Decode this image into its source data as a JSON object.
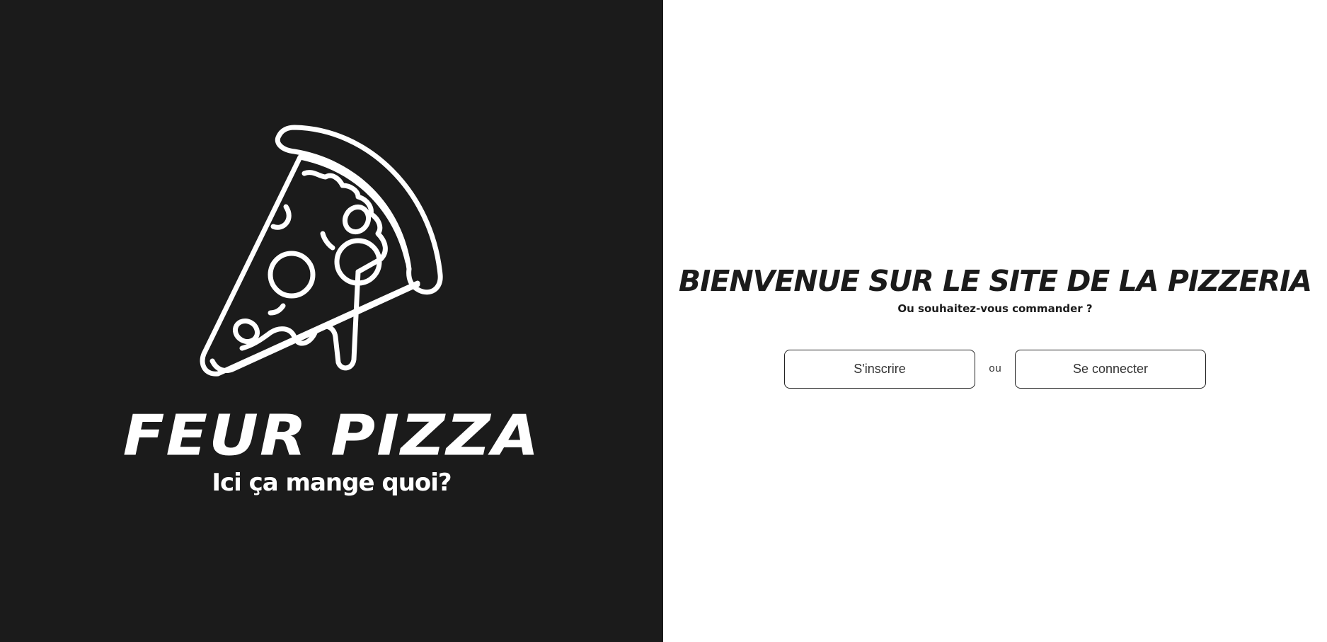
{
  "brand": {
    "name": "FEUR PIZZA",
    "tagline": "Ici ça mange quoi?",
    "logo_icon": "pizza-slice-icon"
  },
  "welcome": {
    "title": "BIENVENUE SUR LE SITE DE LA PIZZERIA",
    "subtitle": "Ou souhaitez-vous commander ?"
  },
  "actions": {
    "signup_label": "S'inscrire",
    "separator": "ou",
    "login_label": "Se connecter"
  },
  "colors": {
    "left_background": "#1b1b1b",
    "right_background": "#ffffff",
    "logo_stroke": "#ffffff",
    "text_dark": "#1b1b1b"
  }
}
